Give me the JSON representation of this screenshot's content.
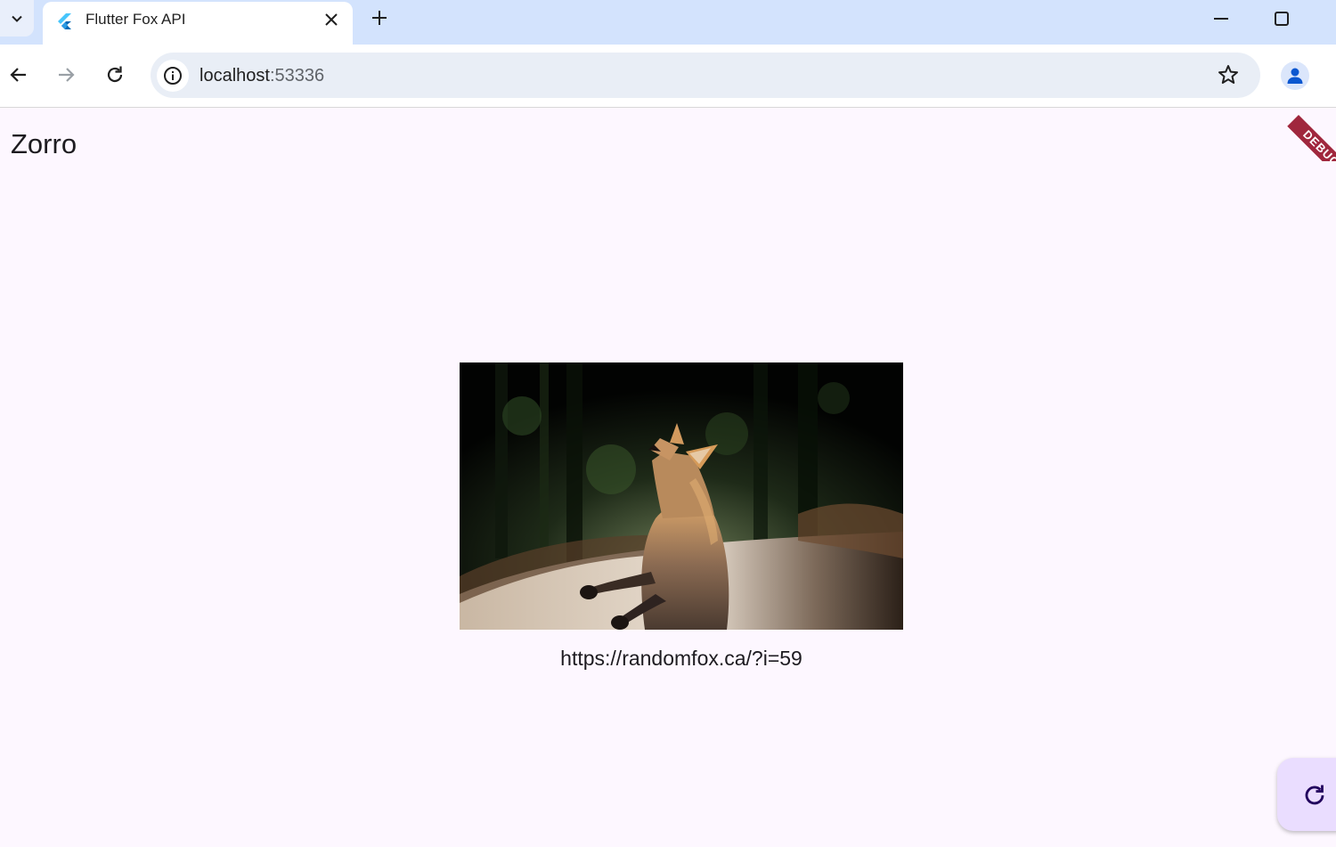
{
  "browser": {
    "tab_title": "Flutter Fox API",
    "url_host": "localhost",
    "url_port": ":53336"
  },
  "app": {
    "title": "Zorro",
    "debug_banner": "DEBUG",
    "image_url": "https://randomfox.ca/?i=59",
    "image_alt": "fox standing on hind legs in a forest",
    "refresh_icon": "refresh-icon"
  },
  "colors": {
    "background": "#fdf7ff",
    "tabbar": "#d3e3fd",
    "fab": "#eaddff",
    "fab_icon": "#21005d",
    "debug_ribbon": "#a0273d"
  }
}
